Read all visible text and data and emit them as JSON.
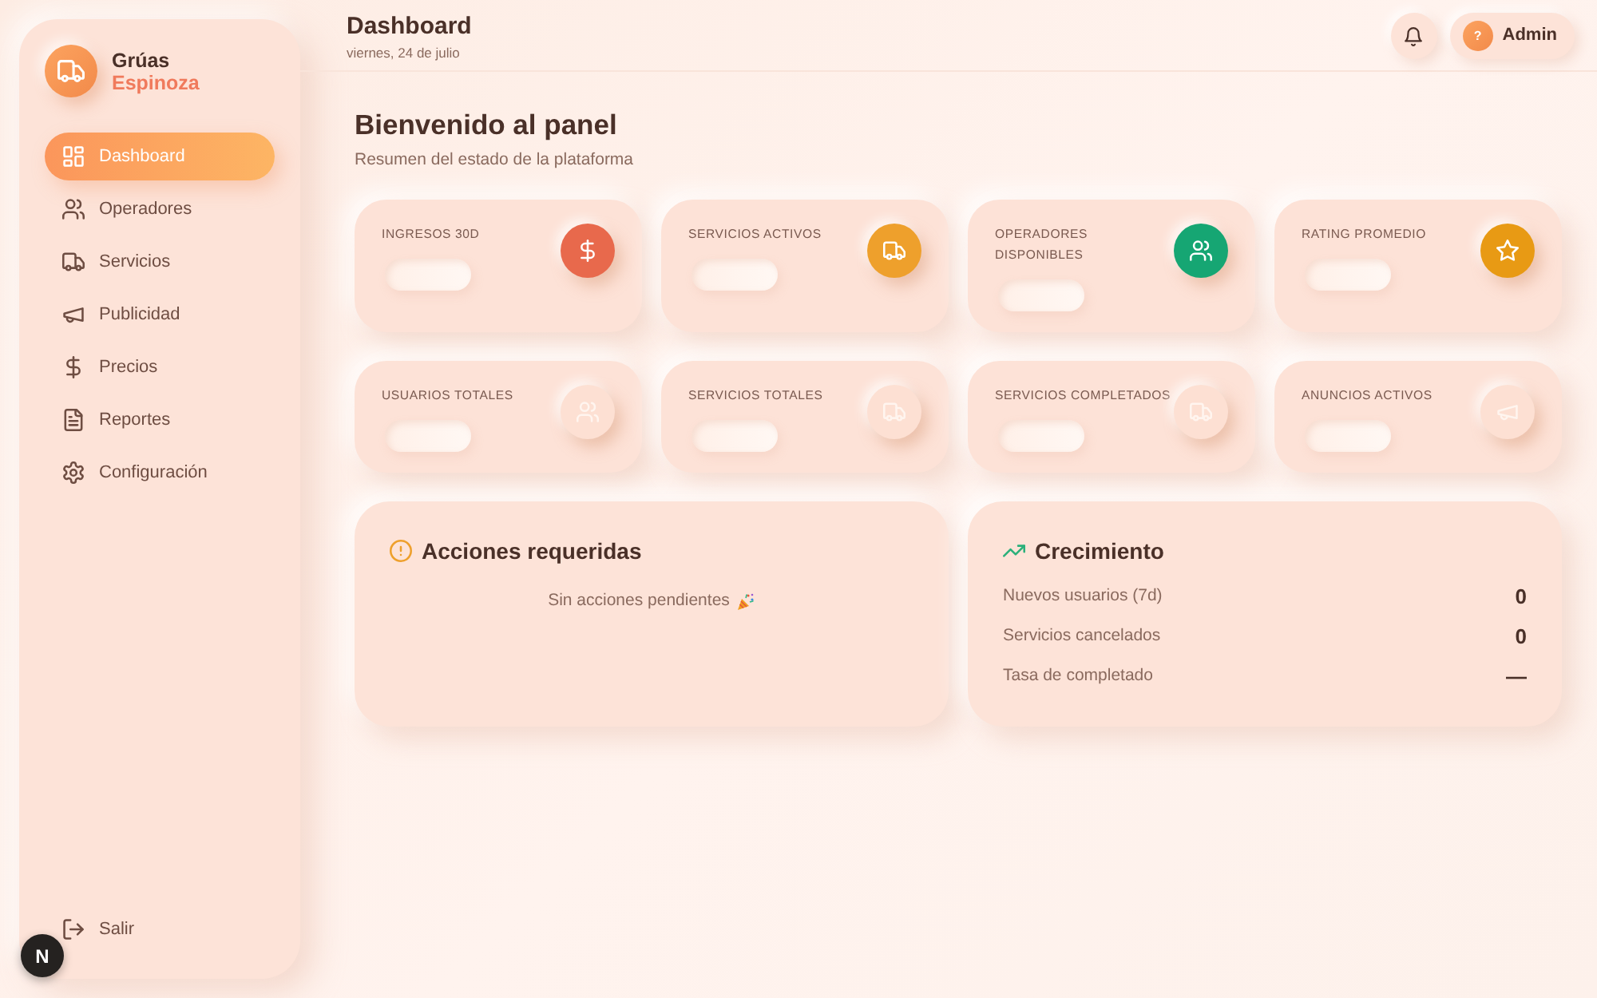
{
  "brand": {
    "name": "Grúas",
    "subtitle": "Espinoza"
  },
  "sidebar": {
    "items": [
      {
        "label": "Dashboard",
        "selected": true
      },
      {
        "label": "Operadores",
        "selected": false
      },
      {
        "label": "Servicios",
        "selected": false
      },
      {
        "label": "Publicidad",
        "selected": false
      },
      {
        "label": "Precios",
        "selected": false
      },
      {
        "label": "Reportes",
        "selected": false
      },
      {
        "label": "Configuración",
        "selected": false
      }
    ],
    "logout": {
      "label": "Salir"
    }
  },
  "header": {
    "title": "Dashboard",
    "date": "viernes, 24 de julio",
    "user": {
      "initial": "?",
      "name": "Admin"
    }
  },
  "welcome": {
    "title": "Bienvenido al panel",
    "subtitle": "Resumen del estado de la plataforma"
  },
  "stats": [
    {
      "label": "INGRESOS 30D",
      "kind": "accent",
      "color": "#e8694c"
    },
    {
      "label": "SERVICIOS ACTIVOS",
      "kind": "accent",
      "color": "#eea02c"
    },
    {
      "label": "OPERADORES DISPONIBLES",
      "kind": "accent",
      "color": "#16a673"
    },
    {
      "label": "RATING PROMEDIO",
      "kind": "accent",
      "color": "#e89a14"
    },
    {
      "label": "USUARIOS TOTALES",
      "kind": "muted"
    },
    {
      "label": "SERVICIOS TOTALES",
      "kind": "muted"
    },
    {
      "label": "SERVICIOS COMPLETADOS",
      "kind": "muted"
    },
    {
      "label": "ANUNCIOS ACTIVOS",
      "kind": "muted"
    }
  ],
  "actions": {
    "title": "Acciones requeridas",
    "empty": "Sin acciones pendientes"
  },
  "growth": {
    "title": "Crecimiento",
    "rows": [
      {
        "label": "Nuevos usuarios (7d)",
        "value": "0"
      },
      {
        "label": "Servicios cancelados",
        "value": "0"
      },
      {
        "label": "Tasa de completado",
        "value": "—"
      }
    ]
  },
  "dev_badge": {
    "label": "N"
  }
}
